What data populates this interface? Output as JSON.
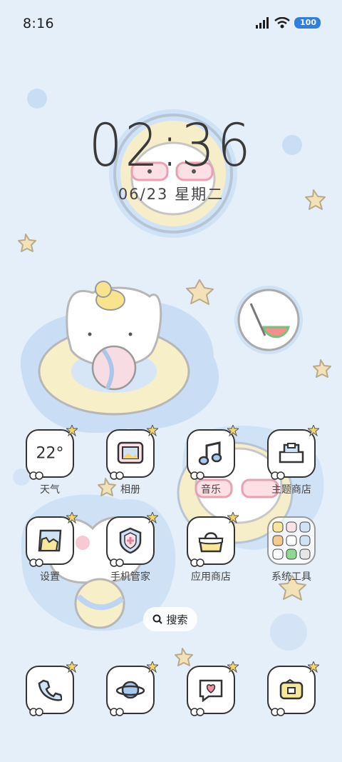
{
  "status_bar": {
    "time": "8:16",
    "battery": "100"
  },
  "lockclock": {
    "time": "02:36",
    "date": "06/23 星期二"
  },
  "weather": {
    "temp": "22°"
  },
  "apps_row1": [
    {
      "label": "天气",
      "icon": "weather-icon"
    },
    {
      "label": "相册",
      "icon": "gallery-icon"
    },
    {
      "label": "音乐",
      "icon": "music-icon"
    },
    {
      "label": "主题商店",
      "icon": "theme-store-icon"
    }
  ],
  "apps_row2": [
    {
      "label": "设置",
      "icon": "settings-icon"
    },
    {
      "label": "手机管家",
      "icon": "security-icon"
    },
    {
      "label": "应用商店",
      "icon": "app-store-icon"
    },
    {
      "label": "系统工具",
      "icon": "folder-icon"
    }
  ],
  "search": {
    "label": "搜索"
  },
  "dock": [
    {
      "icon": "phone-icon"
    },
    {
      "icon": "browser-icon"
    },
    {
      "icon": "messages-icon"
    },
    {
      "icon": "wallet-icon"
    }
  ],
  "colors": {
    "background": "#e3effb",
    "accent_blue": "#c6dcf5",
    "float_yellow": "#f7efc8",
    "star": "#f3e2b8",
    "battery": "#2f7fe0"
  }
}
